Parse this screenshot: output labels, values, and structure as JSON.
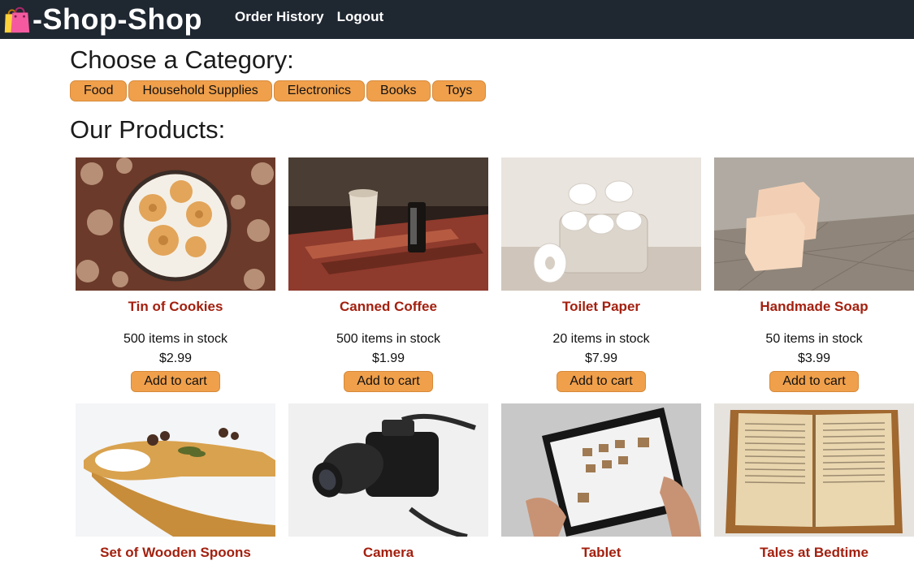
{
  "header": {
    "brand": "-Shop-Shop",
    "nav": [
      "Order History",
      "Logout"
    ]
  },
  "categories": {
    "heading": "Choose a Category:",
    "items": [
      "Food",
      "Household Supplies",
      "Electronics",
      "Books",
      "Toys"
    ]
  },
  "products": {
    "heading": "Our Products:",
    "items": [
      {
        "name": "Tin of Cookies",
        "stock": "500 items in stock",
        "price": "$2.99",
        "cta": "Add to cart"
      },
      {
        "name": "Canned Coffee",
        "stock": "500 items in stock",
        "price": "$1.99",
        "cta": "Add to cart"
      },
      {
        "name": "Toilet Paper",
        "stock": "20 items in stock",
        "price": "$7.99",
        "cta": "Add to cart"
      },
      {
        "name": "Handmade Soap",
        "stock": "50 items in stock",
        "price": "$3.99",
        "cta": "Add to cart"
      },
      {
        "name": "Set of Wooden Spoons"
      },
      {
        "name": "Camera"
      },
      {
        "name": "Tablet"
      },
      {
        "name": "Tales at Bedtime"
      }
    ]
  },
  "colors": {
    "header_bg": "#1f2731",
    "accent": "#f0a04b",
    "product_title": "#a3200f"
  },
  "icons": {
    "brand": "shopping-bags-icon"
  }
}
